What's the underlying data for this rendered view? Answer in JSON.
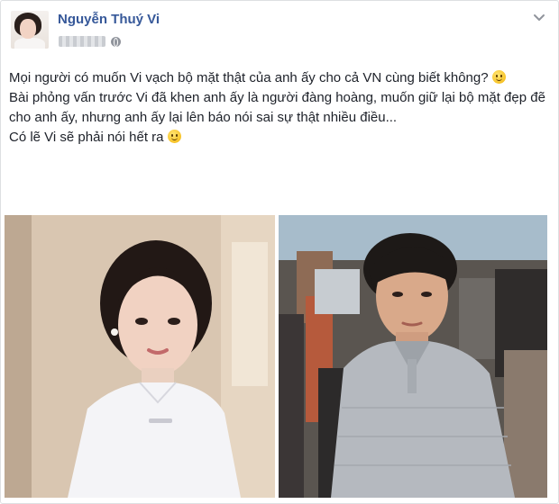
{
  "post": {
    "author_name": "Nguyễn Thuý Vi",
    "paragraphs": [
      "Mọi người có muốn Vi vạch bộ mặt thật của anh ấy cho cả VN cùng biết không?",
      "Bài phỏng vấn trước Vi đã khen anh ấy là người đàng hoàng, muốn giữ lại bộ mặt đẹp đẽ cho anh ấy, nhưng anh ấy lại lên báo nói sai sự thật nhiều điều...",
      "Có lẽ Vi sẽ phải nói hết ra"
    ]
  },
  "icons": {
    "privacy": "globe-icon",
    "options": "chevron-down-icon",
    "emoji": "smiley-emoji-icon"
  },
  "colors": {
    "author_link": "#365899",
    "text": "#1d2129",
    "border": "#dddfe2"
  }
}
